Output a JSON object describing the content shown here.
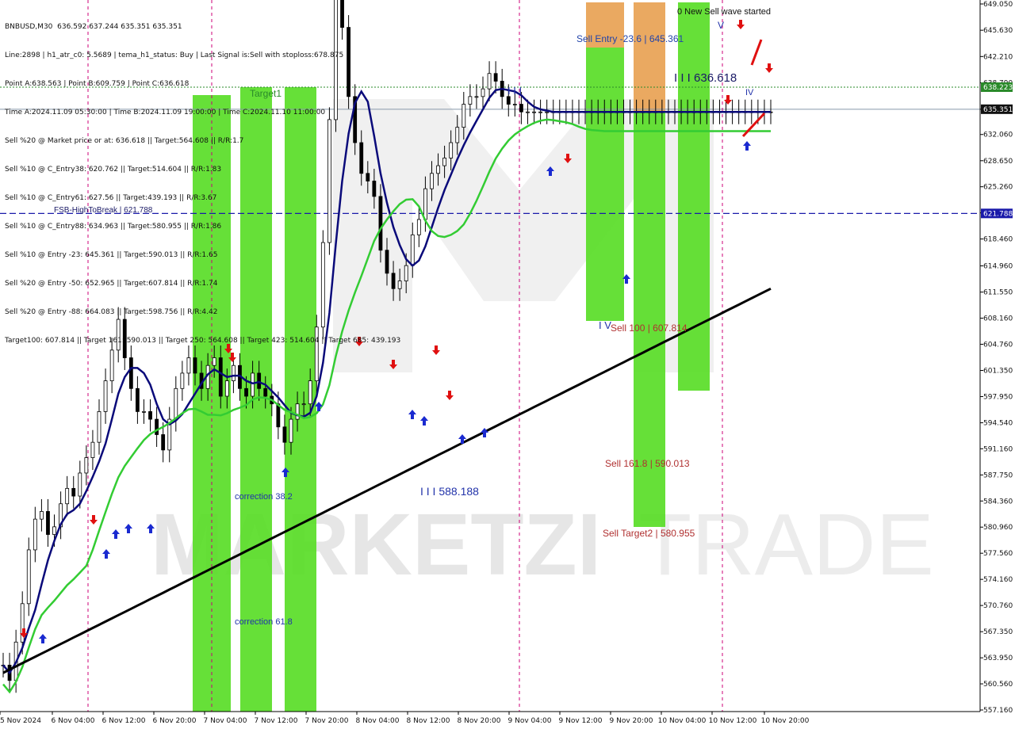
{
  "header": {
    "symbol_line": "BNBUSD,M30  636.592 637.244 635.351 635.351",
    "info_lines": [
      "Line:2898 | h1_atr_c0: 5.5689 | tema_h1_status: Buy | Last Signal is:Sell with stoploss:678.875",
      "Point A:638.563 | Point B:609.759 | Point C:636.618",
      "Time A:2024.11.09 05:30:00 | Time B:2024.11.09 19:00:00 | Time C:2024.11.10 11:00:00",
      "Sell %20 @ Market price or at: 636.618 || Target:564.608 || R/R:1.7",
      "Sell %10 @ C_Entry38: 620.762 || Target:514.604 || R/R:1.83",
      "Sell %10 @ C_Entry61: 627.56 || Target:439.193 || R/R:3.67",
      "Sell %10 @ C_Entry88: 634.963 || Target:580.955 || R/R:1.86",
      "Sell %10 @ Entry -23: 645.361 || Target:590.013 || R/R:1.65",
      "Sell %20 @ Entry -50: 652.965 || Target:607.814 || R/R:1.74",
      "Sell %20 @ Entry -88: 664.083 || Target:598.756 || R/R:4.42",
      "Target100: 607.814 || Target 161: 590.013 || Target 250: 564.608 || Target 423: 514.604 || Target 685: 439.193"
    ]
  },
  "chart_data": {
    "type": "line",
    "title": "",
    "x_ticks": [
      "5 Nov 2024",
      "6 Nov 04:00",
      "6 Nov 12:00",
      "6 Nov 20:00",
      "7 Nov 04:00",
      "7 Nov 12:00",
      "7 Nov 20:00",
      "8 Nov 04:00",
      "8 Nov 12:00",
      "8 Nov 20:00",
      "9 Nov 04:00",
      "9 Nov 12:00",
      "9 Nov 20:00",
      "10 Nov 04:00",
      "10 Nov 12:00",
      "10 Nov 20:00"
    ],
    "y_ticks": [
      "649.050",
      "645.630",
      "642.210",
      "638.790",
      "635.350",
      "632.060",
      "628.650",
      "625.260",
      "621.860",
      "618.460",
      "614.960",
      "611.550",
      "608.160",
      "604.760",
      "601.350",
      "597.950",
      "594.540",
      "591.160",
      "587.750",
      "584.360",
      "580.960",
      "577.560",
      "574.160",
      "570.760",
      "567.350",
      "563.950",
      "560.560",
      "557.160"
    ],
    "ylim": [
      557.16,
      649.05
    ],
    "price_labels": {
      "green": "638.223",
      "current": "635.351",
      "blue": "621.788"
    },
    "levels": {
      "target_line": 638.223,
      "current_price": 635.351,
      "fsb_line": 621.788
    },
    "series": [
      {
        "name": "price",
        "x": [
          0,
          2,
          4,
          6,
          8,
          10,
          12,
          14,
          16,
          18,
          20,
          22,
          24,
          26,
          28,
          30,
          32,
          34,
          36,
          38,
          40,
          42,
          44,
          46,
          48,
          50,
          52,
          54,
          56,
          58,
          60,
          62,
          64,
          66,
          68,
          70,
          72,
          74,
          76,
          78,
          80,
          82,
          84,
          86,
          88,
          90,
          92,
          94,
          96,
          98,
          100,
          102,
          104,
          106,
          108,
          110,
          112,
          114,
          116,
          118,
          120,
          122,
          124,
          126,
          128,
          130,
          132,
          134,
          136,
          138,
          140,
          142,
          144,
          146,
          148,
          150,
          152,
          154,
          156,
          158,
          160,
          162,
          164,
          166,
          168,
          170,
          172,
          174,
          176,
          178,
          180,
          182,
          184,
          186,
          188,
          190,
          192,
          194,
          196,
          198,
          200,
          202,
          204,
          206,
          208,
          210,
          212,
          214,
          216,
          218,
          220,
          222,
          224,
          226,
          228,
          230,
          232,
          234,
          236,
          238,
          240
        ],
        "values": [
          563,
          561,
          566,
          571,
          578,
          582,
          583,
          580,
          581,
          584,
          586,
          585,
          588,
          590,
          592,
          596,
          600,
          604,
          608,
          603,
          599,
          596,
          596,
          595,
          593,
          591,
          595,
          599,
          601,
          603,
          601,
          599,
          602,
          603,
          598,
          600,
          602,
          599,
          598,
          601,
          599,
          598,
          597,
          594,
          592,
          595,
          597,
          597,
          600,
          607,
          618,
          634,
          651,
          646,
          637,
          631,
          627,
          626,
          624,
          617,
          614,
          612,
          613,
          615,
          619,
          621,
          625,
          627,
          628,
          629,
          631,
          633,
          636,
          637,
          637,
          638,
          640,
          639,
          637,
          636,
          636,
          635,
          635,
          635,
          635,
          635,
          635,
          635,
          635,
          635,
          635,
          635,
          635,
          635,
          635,
          635,
          635,
          635,
          635,
          635,
          635,
          635,
          635,
          635,
          635,
          635,
          635,
          635,
          635,
          635,
          635,
          635,
          635,
          635,
          635,
          635,
          635,
          635,
          635,
          635,
          635
        ]
      },
      {
        "name": "ma-blue",
        "values": []
      },
      {
        "name": "ma-green",
        "values": []
      },
      {
        "name": "ma-black",
        "values": []
      }
    ]
  },
  "annotations": {
    "fsb": "FSB-HighToBreak | 621.788",
    "target1": "Target1",
    "sell_entry": "Sell Entry -23.6 | 645.361",
    "wave_started": "0 New Sell wave started",
    "point_c": "I I I 636.618",
    "point_a": "I I I",
    "point_b": "I V",
    "sell100": "Sell 100 | 607.814",
    "sell161": "Sell 161.8 | 590.013",
    "sell_target2": "Sell Target2 | 580.955",
    "low_label": "I I I 588.188",
    "corr38": "correction 38.2",
    "corr61": "correction 61.8",
    "wave_v": "V",
    "point_iv": "IV"
  },
  "watermark": {
    "text_bold": "MARKETZI",
    "text_light": "TRADE"
  },
  "colors": {
    "background": "#ffffff",
    "green_zone": "#55dd22",
    "orange_zone": "#e8a050",
    "ma_blue": "#0a0a7a",
    "ma_green": "#33cc33",
    "ma_black": "#000000",
    "dashed_blue": "#1a1aaa",
    "dashed_green": "#2a8a2a",
    "magenta": "#cc0077",
    "red_text": "#b03030",
    "blue_text": "#2233aa"
  }
}
